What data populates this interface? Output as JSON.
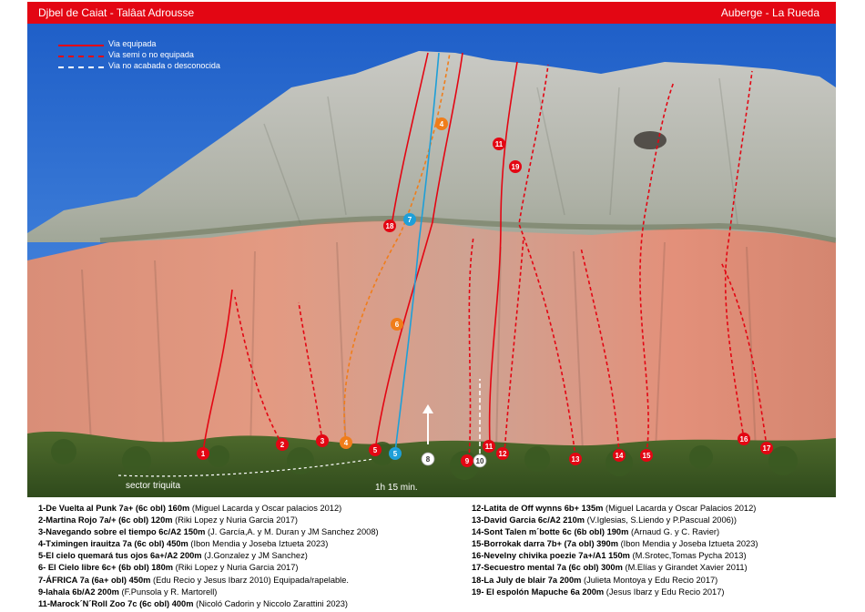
{
  "header": {
    "title_left": "Djbel de Caiat - Talâat Adrousse",
    "title_right": "Auberge - La Rueda",
    "color": "#e30613"
  },
  "legend": [
    {
      "label": "Via equipada",
      "style": "solid",
      "color": "#e30613"
    },
    {
      "label": "Via semi o no equipada",
      "style": "dashed",
      "color": "#e30613"
    },
    {
      "label": "Via no acabada o desconocida",
      "style": "dashed",
      "color": "#ffffff"
    }
  ],
  "photo_labels": {
    "sector": "sector triquita",
    "approach": "1h 15 min."
  },
  "route_markers": [
    {
      "num": "1",
      "color": "#e30613"
    },
    {
      "num": "2",
      "color": "#e30613"
    },
    {
      "num": "3",
      "color": "#e30613"
    },
    {
      "num": "4",
      "color": "#f07d1a"
    },
    {
      "num": "4",
      "color": "#f07d1a"
    },
    {
      "num": "5",
      "color": "#e30613"
    },
    {
      "num": "5",
      "color": "#1e9fd8"
    },
    {
      "num": "6",
      "color": "#f07d1a"
    },
    {
      "num": "7",
      "color": "#1e9fd8"
    },
    {
      "num": "8",
      "color": "#ffffff"
    },
    {
      "num": "9",
      "color": "#e30613"
    },
    {
      "num": "10",
      "color": "#ffffff"
    },
    {
      "num": "11",
      "color": "#e30613"
    },
    {
      "num": "11",
      "color": "#e30613"
    },
    {
      "num": "12",
      "color": "#e30613"
    },
    {
      "num": "13",
      "color": "#e30613"
    },
    {
      "num": "14",
      "color": "#e30613"
    },
    {
      "num": "15",
      "color": "#e30613"
    },
    {
      "num": "16",
      "color": "#e30613"
    },
    {
      "num": "17",
      "color": "#e30613"
    },
    {
      "num": "18",
      "color": "#e30613"
    },
    {
      "num": "19",
      "color": "#e30613"
    }
  ],
  "routes_left": [
    {
      "name": "1-De Vuelta al Punk 7a+ (6c obl) 160m",
      "credit": "(Miguel Lacarda y Oscar palacios 2012)"
    },
    {
      "name": "2-Martina Rojo 7a/+ (6c obl) 120m",
      "credit": "(Riki Lopez y Nuria Garcia 2017)"
    },
    {
      "name": "3-Navegando sobre el tiempo 6c/A2 150m",
      "credit": "(J. García,A. y M. Duran y JM Sanchez 2008)"
    },
    {
      "name": "4-Tximingen irauitza 7a (6c obl) 450m",
      "credit": "(Ibon Mendia y Joseba Iztueta 2023)"
    },
    {
      "name": "5-El cielo quemará tus ojos 6a+/A2 200m",
      "credit": "(J.Gonzalez y JM Sanchez)"
    },
    {
      "name": "6- El Cielo libre 6c+ (6b obl) 180m",
      "credit": "(Riki Lopez y Nuria Garcia 2017)"
    },
    {
      "name": "7-ÁFRICA 7a (6a+ obl) 450m",
      "credit": "(Edu Recio y Jesus Ibarz 2010) Equipada/rapelable."
    },
    {
      "name": "9-Iahala 6b/A2 200m",
      "credit": "(F.Punsola y R. Martorell)"
    },
    {
      "name": "11-Marock´N´Roll Zoo 7c (6c obl) 400m",
      "credit": "(Nicoló Cadorin y Niccolo Zarattini 2023)"
    }
  ],
  "routes_right": [
    {
      "name": "12-Latita de Off wynns 6b+ 135m",
      "credit": "(Miguel Lacarda y Oscar Palacios 2012)"
    },
    {
      "name": "13-David Garcia 6c/A2 210m",
      "credit": "(V.Iglesias, S.Liendo y P.Pascual 2006))"
    },
    {
      "name": "14-Sont Talen m´botte 6c (6b obl) 190m",
      "credit": "(Arnaud G. y C. Ravier)"
    },
    {
      "name": "15-Borrokak darra 7b+ (7a obl) 390m",
      "credit": "(Ibon Mendia y Joseba Iztueta 2023)"
    },
    {
      "name": "16-Nevelny chivika poezie 7a+/A1  150m",
      "credit": "(M.Srotec,Tomas Pycha 2013)"
    },
    {
      "name": "17-Secuestro mental 7a (6c obl) 300m",
      "credit": "(M.Elías y Girandet Xavier 2011)"
    },
    {
      "name": "18-La July de blair 7a 200m",
      "credit": "(Julieta Montoya y Edu Recio 2017)"
    },
    {
      "name": "19- El espolón Mapuche 6a 200m",
      "credit": "(Jesus Ibarz y Edu Recio 2017)"
    }
  ]
}
